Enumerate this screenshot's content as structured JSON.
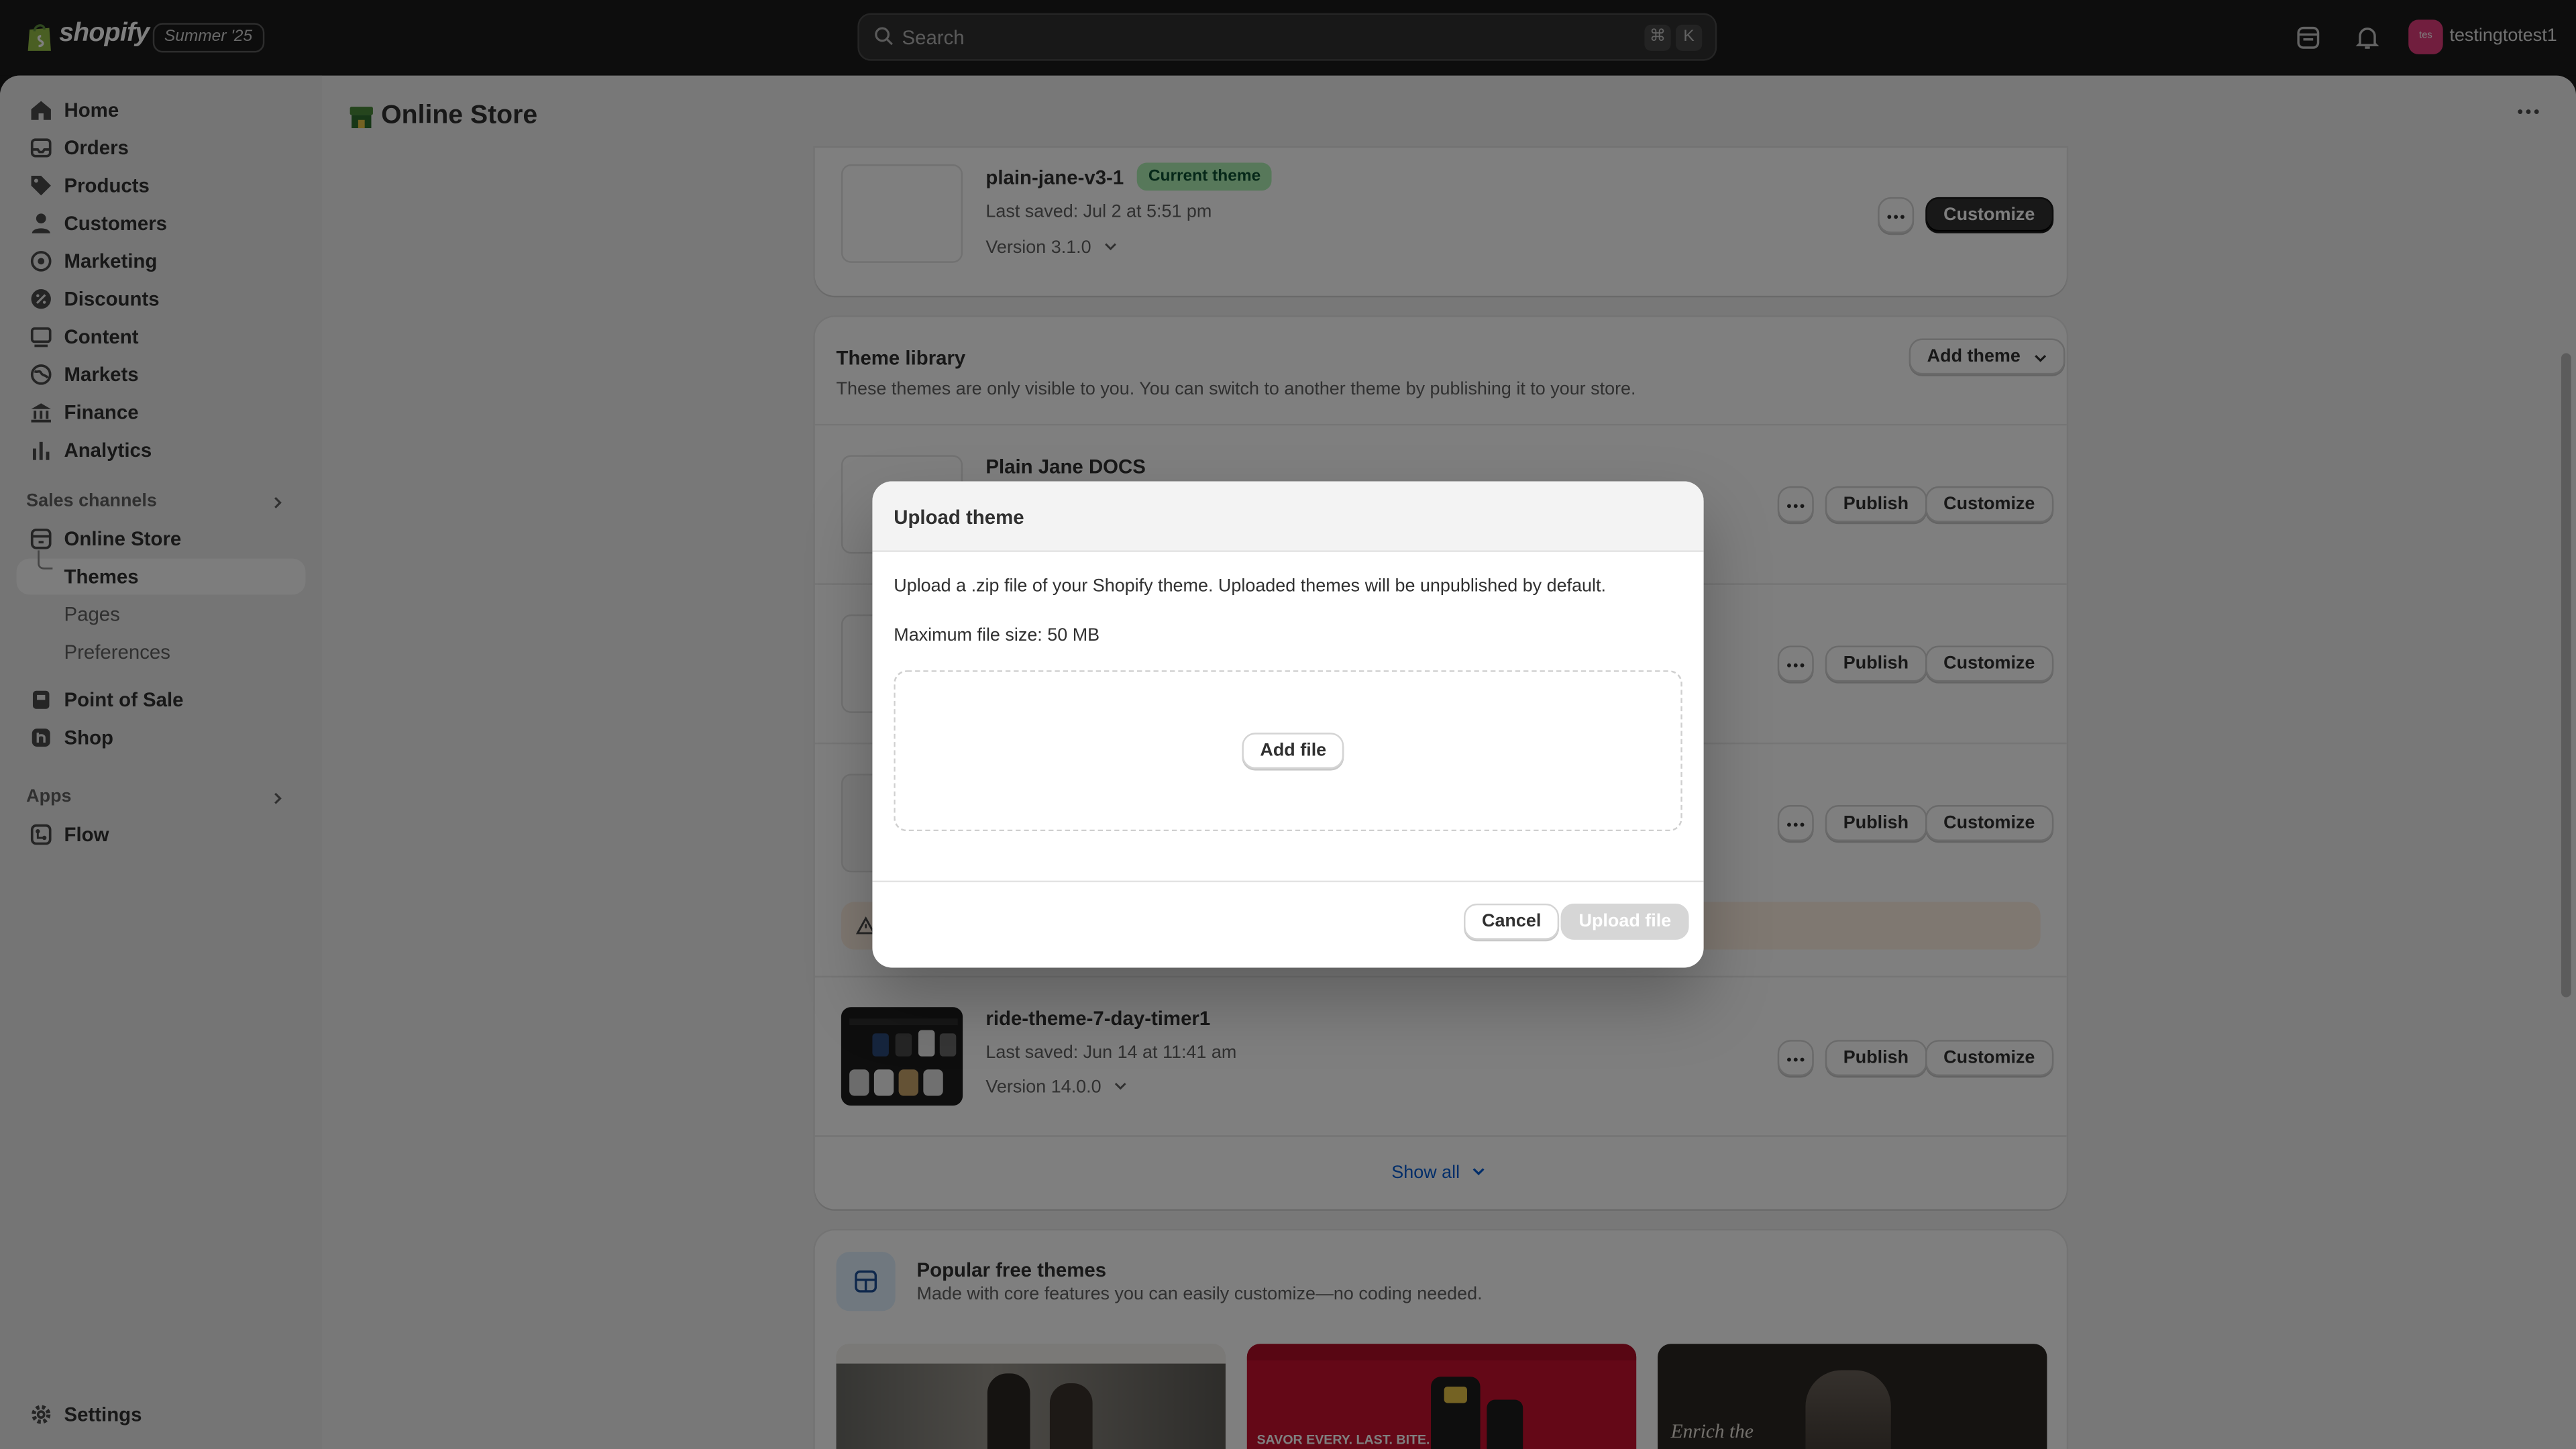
{
  "topbar": {
    "brand": "shopify",
    "edition": "Summer '25",
    "search_placeholder": "Search",
    "shortcut_keys": [
      "⌘",
      "K"
    ],
    "avatar_initials": "tes",
    "store_name": "testingtotest1"
  },
  "sidebar": {
    "items": [
      {
        "label": "Home",
        "icon": "home-icon"
      },
      {
        "label": "Orders",
        "icon": "inbox-icon"
      },
      {
        "label": "Products",
        "icon": "tag-icon"
      },
      {
        "label": "Customers",
        "icon": "person-icon"
      },
      {
        "label": "Marketing",
        "icon": "target-icon"
      },
      {
        "label": "Discounts",
        "icon": "discount-icon"
      },
      {
        "label": "Content",
        "icon": "content-icon"
      },
      {
        "label": "Markets",
        "icon": "globe-icon"
      },
      {
        "label": "Finance",
        "icon": "bank-icon"
      },
      {
        "label": "Analytics",
        "icon": "bar-chart-icon"
      }
    ],
    "sales_channels_label": "Sales channels",
    "online_store": "Online Store",
    "sub_items": [
      "Themes",
      "Pages",
      "Preferences"
    ],
    "channels": [
      "Point of Sale",
      "Shop"
    ],
    "apps_label": "Apps",
    "apps": [
      "Flow"
    ],
    "settings": "Settings"
  },
  "page": {
    "title": "Online Store"
  },
  "current_theme": {
    "name": "plain-jane-v3-1",
    "badge": "Current theme",
    "last_saved": "Last saved: Jul 2 at 5:51 pm",
    "version": "Version 3.1.0",
    "customize": "Customize"
  },
  "library": {
    "title": "Theme library",
    "description": "These themes are only visible to you. You can switch to another theme by publishing it to your store.",
    "add_theme": "Add theme",
    "themes": [
      {
        "name": "Plain Jane DOCS"
      },
      {
        "name": ""
      },
      {
        "name": ""
      },
      {
        "name": "ride-theme-7-day-timer1",
        "last_saved": "Last saved: Jun 14 at 11:41 am",
        "version": "Version 14.0.0"
      }
    ],
    "publish": "Publish",
    "customize": "Customize",
    "show_all": "Show all"
  },
  "popular": {
    "title": "Popular free themes",
    "description": "Made with core features you can easily customize—no coding needed.",
    "previews": [
      {
        "caption": ""
      },
      {
        "caption": "SAVOR EVERY. LAST. BITE."
      },
      {
        "caption": "Enrich the"
      }
    ]
  },
  "modal": {
    "title": "Upload theme",
    "description": "Upload a .zip file of your Shopify theme. Uploaded themes will be unpublished by default.",
    "max_size": "Maximum file size: 50 MB",
    "add_file": "Add file",
    "cancel": "Cancel",
    "upload": "Upload file"
  },
  "colors": {
    "accent_dark": "#303030",
    "badge_success_bg": "#aff0b5",
    "link_blue": "#005bd3",
    "avatar": "#e23c7c"
  }
}
